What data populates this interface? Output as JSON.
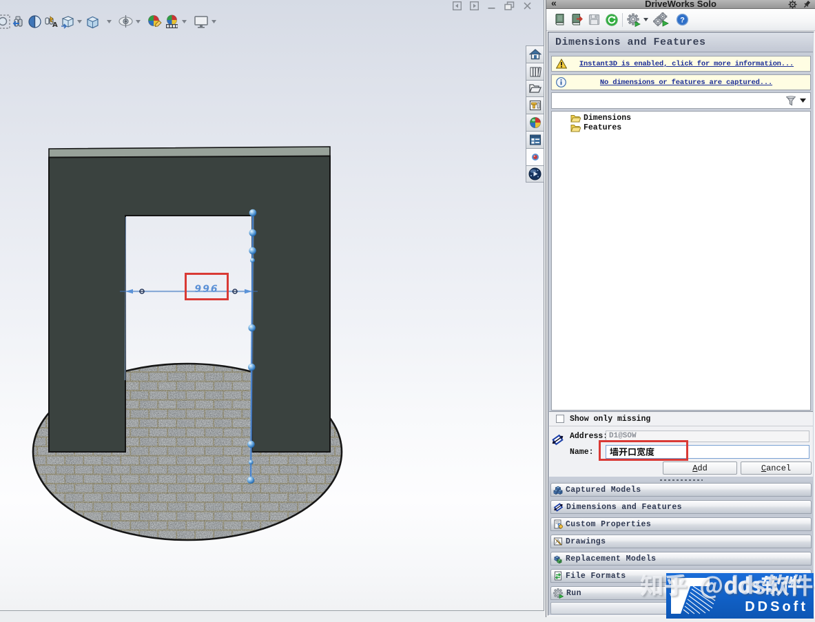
{
  "viewport": {
    "dimension_value": "996",
    "hud_toolbar": [
      "zoom-to-fit",
      "zoom-to-area",
      "previous-view",
      "section-view",
      "annotation-views",
      "view-orientation",
      "display-style",
      "hide-show-items",
      "edit-appearance",
      "apply-scene",
      "view-settings"
    ],
    "window_controls": [
      "previous-window",
      "next-window",
      "minimize",
      "restore",
      "close"
    ],
    "task_pane_tabs": [
      "home",
      "design-library",
      "file-explorer",
      "palette",
      "appearances",
      "custom-properties",
      "forum",
      "driveworks"
    ]
  },
  "panel": {
    "title": "DriveWorks Solo",
    "collapse_glyph": "«",
    "toolbar": [
      "new-project",
      "open-project",
      "save",
      "refresh",
      "settings",
      "generate",
      "help"
    ],
    "section_title": "Dimensions and Features",
    "notifications": {
      "warning": "Instant3D is enabled, click for more information...",
      "info": "No dimensions or features are captured..."
    },
    "tree": {
      "items": [
        {
          "label": "Dimensions"
        },
        {
          "label": "Features"
        }
      ]
    },
    "show_only_missing_label": "Show only missing",
    "form": {
      "address_label": "Address:",
      "address_value": "D1@SOW",
      "name_label": "Name:",
      "name_value": "墙开口宽度"
    },
    "buttons": {
      "add": "Add",
      "cancel": "Cancel"
    },
    "accordion": [
      {
        "label": "Captured Models"
      },
      {
        "label": "Dimensions and Features"
      },
      {
        "label": "Custom Properties"
      },
      {
        "label": "Drawings"
      },
      {
        "label": "Replacement Models"
      },
      {
        "label": "File Formats"
      },
      {
        "label": "Run"
      }
    ]
  },
  "watermark": {
    "text": "知乎 @dds软件",
    "brand_overlay_text": "dds软件",
    "brand_name": "DDSoft",
    "brand_blue": "#1160c6"
  }
}
